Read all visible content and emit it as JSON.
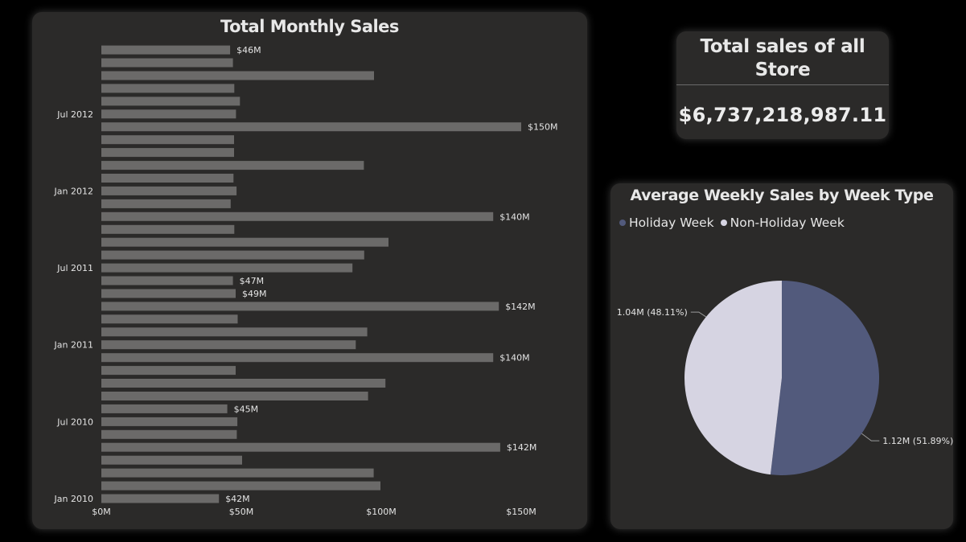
{
  "bar_chart": {
    "title": "Total Monthly Sales",
    "y_tick_labels": [
      "Jan 2010",
      "Jul 2010",
      "Jan 2011",
      "Jul 2011",
      "Jan 2012",
      "Jul 2012"
    ],
    "x_tick_labels": [
      "$0M",
      "$50M",
      "$100M",
      "$150M"
    ],
    "bar_color": "#6b6a69"
  },
  "kpi": {
    "title": "Total sales of all Store",
    "value": "$6,737,218,987.11"
  },
  "pie_chart": {
    "title": "Average Weekly Sales by Week Type",
    "legend": [
      "Holiday Week",
      "Non-Holiday Week"
    ],
    "colors": [
      "#525a7c",
      "#d6d4e2"
    ],
    "slice_labels": [
      "1.12M (51.89%)",
      "1.04M (48.11%)"
    ]
  },
  "chart_data": [
    {
      "type": "bar",
      "title": "Total Monthly Sales",
      "orientation": "horizontal",
      "xlim": [
        0,
        165
      ],
      "x_unit": "$M",
      "categories": [
        "Jan 2010",
        "Feb 2010",
        "Mar 2010",
        "Apr 2010",
        "May 2010",
        "Jun 2010",
        "Jul 2010",
        "Aug 2010",
        "Sep 2010",
        "Oct 2010",
        "Nov 2010",
        "Dec 2010",
        "Jan 2011",
        "Feb 2011",
        "Mar 2011",
        "Apr 2011",
        "May 2011",
        "Jun 2011",
        "Jul 2011",
        "Aug 2011",
        "Sep 2011",
        "Oct 2011",
        "Nov 2011",
        "Dec 2011",
        "Jan 2012",
        "Feb 2012",
        "Mar 2012",
        "Apr 2012",
        "May 2012",
        "Jun 2012",
        "Jul 2012",
        "Aug 2012",
        "Sep 2012",
        "Oct 2012",
        "Nov 2012",
        "Dec 2012"
      ],
      "values": [
        42,
        99.7,
        97.3,
        50.3,
        142.5,
        48.4,
        48.6,
        45,
        95.3,
        101.5,
        48,
        140,
        90.9,
        95,
        48.7,
        142,
        48,
        47,
        89.7,
        93.9,
        102.6,
        47.5,
        140,
        46.2,
        48.3,
        47.2,
        93.8,
        47.4,
        47.4,
        150,
        48.1,
        49.5,
        47.5,
        97.4,
        47,
        46
      ],
      "data_labels": {
        "Jan 2010": "$42M",
        "May 2010": "$142M",
        "Aug 2010": "$45M",
        "Dec 2010": "$140M",
        "Apr 2011": "$142M",
        "May 2011": "$49M",
        "Jun 2011": "$47M",
        "Nov 2011": "$140M",
        "Jun 2012": "$150M",
        "Dec 2012": "$46M"
      },
      "legend": "none"
    },
    {
      "type": "pie",
      "title": "Average Weekly Sales by Week Type",
      "labels": [
        "Holiday Week",
        "Non-Holiday Week"
      ],
      "values": [
        1.12,
        1.04
      ],
      "percentages": [
        51.89,
        48.11
      ],
      "value_unit": "M",
      "legend": "top-left"
    }
  ]
}
